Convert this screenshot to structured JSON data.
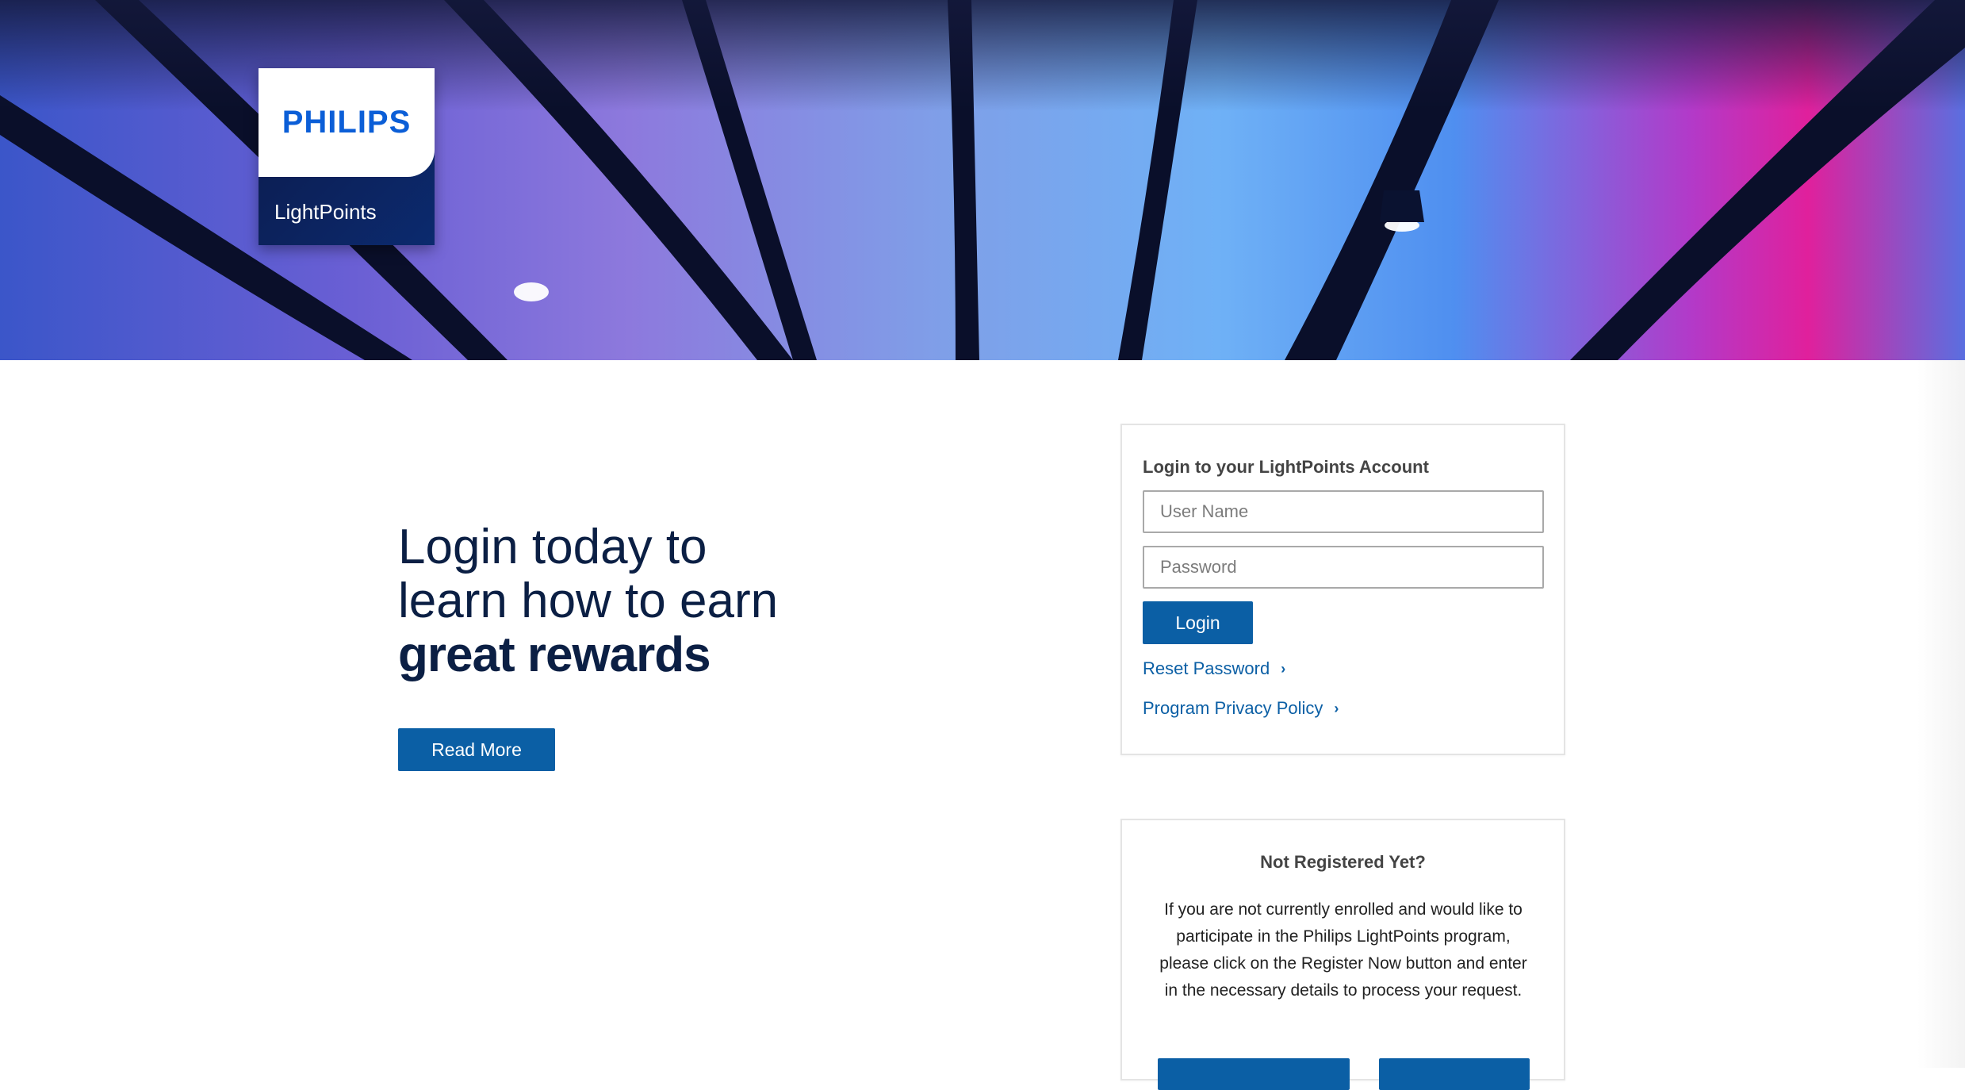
{
  "brand": {
    "name": "PHILIPS",
    "program": "LightPoints"
  },
  "promo": {
    "headline_line1": "Login today to",
    "headline_line2": "learn how to earn",
    "headline_bold": "great rewards",
    "read_more_label": "Read More"
  },
  "login": {
    "title": "Login to your LightPoints Account",
    "username_placeholder": "User Name",
    "password_placeholder": "Password",
    "login_label": "Login",
    "reset_password_label": "Reset Password",
    "privacy_policy_label": "Program Privacy Policy"
  },
  "register": {
    "title": "Not Registered Yet?",
    "body": "If you are not currently enrolled and would like to participate in the Philips LightPoints program, please click on the Register Now button and enter in the necessary details to process your request."
  },
  "colors": {
    "primary_blue": "#0b5fa5",
    "brand_blue": "#0b5ed7",
    "navy_text": "#0b1f44"
  },
  "icons": {
    "link_chevron": "chevron-right-icon"
  }
}
